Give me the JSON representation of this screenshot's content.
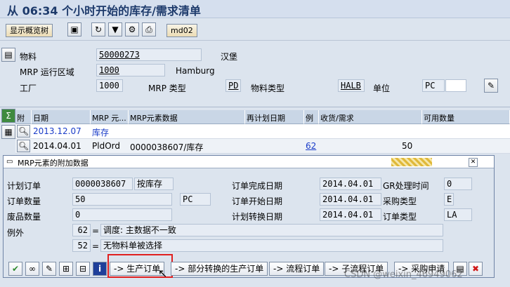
{
  "title": "从 06:34 个小时开始的库存/需求清单",
  "toolbar": {
    "overview_tree": "显示概览树",
    "md02": "md02"
  },
  "header": {
    "material_label": "物料",
    "material_value": "50000273",
    "material_desc": "汉堡",
    "mrp_area_label": "MRP 运行区域",
    "mrp_area_value": "1000",
    "mrp_area_desc": "Hamburg",
    "plant_label": "工厂",
    "plant_value": "1000",
    "mrp_type_label": "MRP 类型",
    "mrp_type_value": "PD",
    "material_type_label": "物料类型",
    "material_type_value": "HALB",
    "unit_label": "单位",
    "unit_value": "PC"
  },
  "grid": {
    "columns": [
      "附",
      "日期",
      "MRP 元...",
      "MRP元素数据",
      "再计划日期",
      "例",
      "收货/需求",
      "可用数量"
    ],
    "rows": [
      {
        "date": "2013.12.07",
        "mrp_elem": "库存",
        "data": "",
        "reschedule": "",
        "exc": "",
        "qty": "",
        "avail": ""
      },
      {
        "date": "2014.04.01",
        "mrp_elem": "PldOrd",
        "data": "0000038607/库存",
        "reschedule": "",
        "exc": "62",
        "qty": "50",
        "avail": ""
      }
    ]
  },
  "dialog": {
    "title": "MRP元素的附加数据",
    "planned_order_label": "计划订单",
    "planned_order_value": "0000038607",
    "planned_order_desc": "按库存",
    "order_qty_label": "订单数量",
    "order_qty_value": "50",
    "order_qty_unit": "PC",
    "scrap_label": "废品数量",
    "scrap_value": "0",
    "exception_label": "例外",
    "exc1_code": "62",
    "exc1_eq": "=",
    "exc1_text": "调度: 主数据不一致",
    "exc2_code": "52",
    "exc2_eq": "=",
    "exc2_text": "无物料单被选择",
    "finish_label": "订单完成日期",
    "finish_value": "2014.04.01",
    "start_label": "订单开始日期",
    "start_value": "2014.04.01",
    "conv_label": "计划转换日期",
    "conv_value": "2014.04.01",
    "gr_time_label": "GR处理时间",
    "gr_time_value": "0",
    "proc_type_label": "采购类型",
    "proc_type_value": "E",
    "order_type_label": "订单类型",
    "order_type_value": "LA",
    "buttons": {
      "prod_order": "-> 生产订单",
      "partial": "-> 部分转换的生产订单",
      "process": "-> 流程订单",
      "sub": "-> 子流程订单",
      "purch": "-> 采购申请"
    }
  },
  "watermark": "CSDN @weixin_46949062"
}
